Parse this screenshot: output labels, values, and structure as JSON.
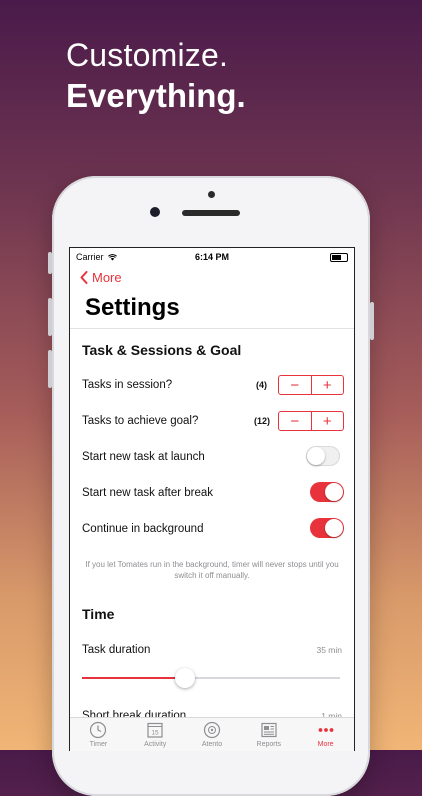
{
  "headline": {
    "line1": "Customize.",
    "line2": "Everything."
  },
  "status_bar": {
    "carrier": "Carrier",
    "time": "6:14 PM"
  },
  "nav": {
    "back_label": "More",
    "title": "Settings"
  },
  "sections": {
    "task": "Task & Sessions & Goal",
    "time": "Time"
  },
  "rows": {
    "tasks_in_session": {
      "label": "Tasks in session?",
      "count": "(4)"
    },
    "tasks_goal": {
      "label": "Tasks to achieve goal?",
      "count": "(12)"
    },
    "start_launch": {
      "label": "Start new task at launch",
      "enabled": false
    },
    "start_after_break": {
      "label": "Start new task after break",
      "enabled": true
    },
    "background": {
      "label": "Continue in background",
      "enabled": true
    },
    "note": "If you let Tomates run in the background, timer will never stops until you switch it off manually.",
    "task_duration": {
      "label": "Task duration",
      "value": "35 min",
      "slider_fraction": 0.4
    },
    "short_break": {
      "label": "Short break duration",
      "value": "1 min"
    }
  },
  "stepper": {
    "minus": "−",
    "plus": "+"
  },
  "tabs": [
    {
      "label": "Timer",
      "icon": "clock-icon",
      "active": false
    },
    {
      "label": "Activity",
      "icon": "calendar-icon",
      "active": false
    },
    {
      "label": "Atento",
      "icon": "atento-icon",
      "active": false
    },
    {
      "label": "Reports",
      "icon": "newspaper-icon",
      "active": false
    },
    {
      "label": "More",
      "icon": "more-dots-icon",
      "active": true
    }
  ],
  "colors": {
    "accent": "#e8333c"
  }
}
